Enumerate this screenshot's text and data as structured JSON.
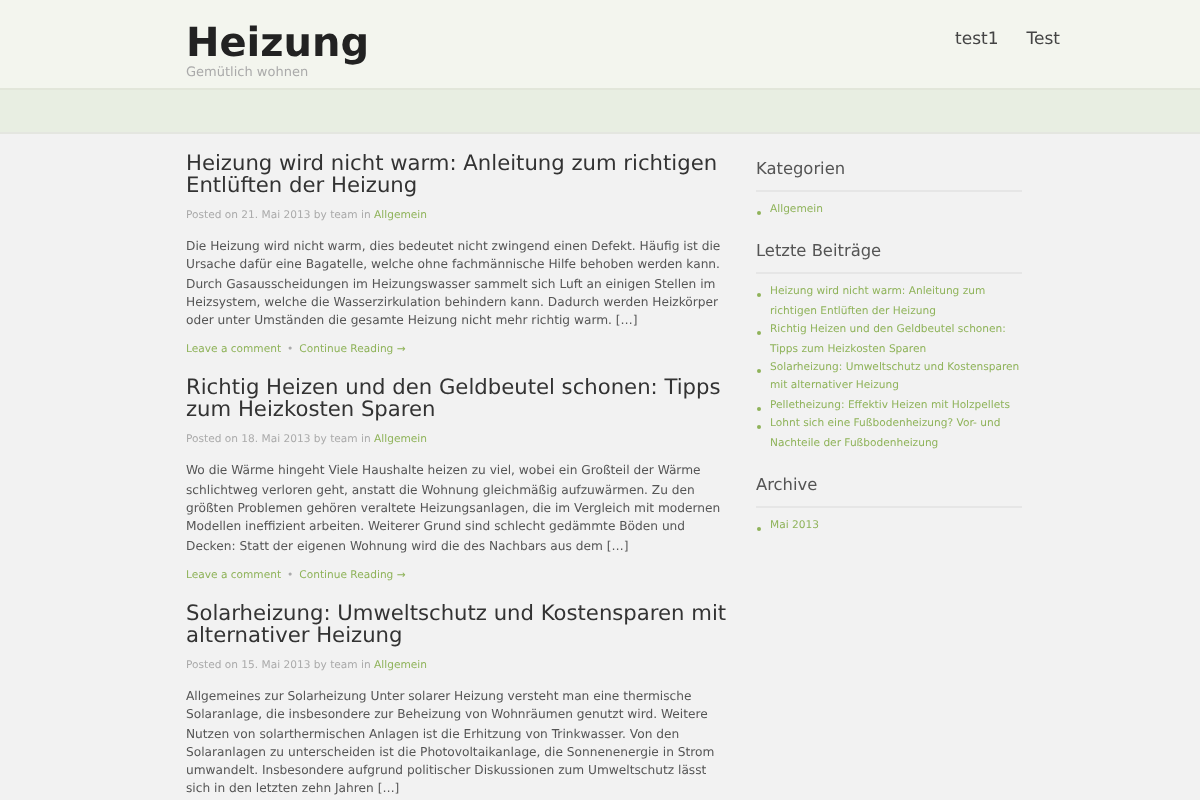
{
  "header": {
    "site_title": "Heizung",
    "tagline": "Gemütlich wohnen",
    "nav": [
      {
        "label": "test1"
      },
      {
        "label": "Test"
      }
    ]
  },
  "posts": [
    {
      "title": "Heizung wird nicht warm: Anleitung zum richtigen Entlüften der Heizung",
      "meta": "Posted on 21. Mai 2013 by team in",
      "category": "Allgemein",
      "excerpt": "Die Heizung wird nicht warm, dies bedeutet nicht zwingend einen Defekt. Häufig ist die Ursache dafür eine Bagatelle, welche ohne fachmännische Hilfe behoben werden kann. Durch Gasausscheidungen im Heizungswasser sammelt sich Luft an einigen Stellen im Heizsystem, welche die Wasserzirkulation behindern kann. Dadurch werden Heizkörper oder unter Umständen die gesamte Heizung nicht mehr richtig warm. […]",
      "comment_link": "Leave a comment",
      "separator": "•",
      "more_link": "Continue Reading →"
    },
    {
      "title": "Richtig Heizen und den Geldbeutel schonen: Tipps zum Heizkosten Sparen",
      "meta": "Posted on 18. Mai 2013 by team in",
      "category": "Allgemein",
      "excerpt": "Wo die Wärme hingeht Viele Haushalte heizen zu viel, wobei ein Großteil der Wärme schlichtweg verloren geht, anstatt die Wohnung gleichmäßig aufzuwärmen. Zu den größten Problemen gehören veraltete Heizungsanlagen, die im Vergleich mit modernen Modellen ineffizient arbeiten. Weiterer Grund sind schlecht gedämmte Böden und Decken: Statt der eigenen Wohnung wird die des Nachbars aus dem […]",
      "comment_link": "Leave a comment",
      "separator": "•",
      "more_link": "Continue Reading →"
    },
    {
      "title": "Solarheizung: Umweltschutz und Kostensparen mit alternativer Heizung",
      "meta": "Posted on 15. Mai 2013 by team in",
      "category": "Allgemein",
      "excerpt": "Allgemeines zur Solarheizung Unter solarer Heizung versteht man eine thermische Solaranlage, die insbesondere zur Beheizung von Wohnräumen genutzt wird. Weitere Nutzen von solarthermischen Anlagen ist die Erhitzung von Trinkwasser. Von den Solaranlagen zu unterscheiden ist die Photovoltaikanlage, die Sonnenenergie in Strom umwandelt. Insbesondere aufgrund politischer Diskussionen zum Umweltschutz lässt sich in den letzten zehn Jahren […]"
    }
  ],
  "sidebar": {
    "widgets": [
      {
        "title": "Kategorien",
        "items": [
          "Allgemein"
        ]
      },
      {
        "title": "Letzte Beiträge",
        "items": [
          "Heizung wird nicht warm: Anleitung zum richtigen Entlüften der Heizung",
          "Richtig Heizen und den Geldbeutel schonen: Tipps zum Heizkosten Sparen",
          "Solarheizung: Umweltschutz und Kostensparen mit alternativer Heizung",
          "Pelletheizung: Effektiv Heizen mit Holzpellets",
          "Lohnt sich eine Fußbodenheizung? Vor- und Nachteile der Fußbodenheizung"
        ]
      },
      {
        "title": "Archive",
        "items": [
          "Mai 2013"
        ]
      }
    ]
  }
}
